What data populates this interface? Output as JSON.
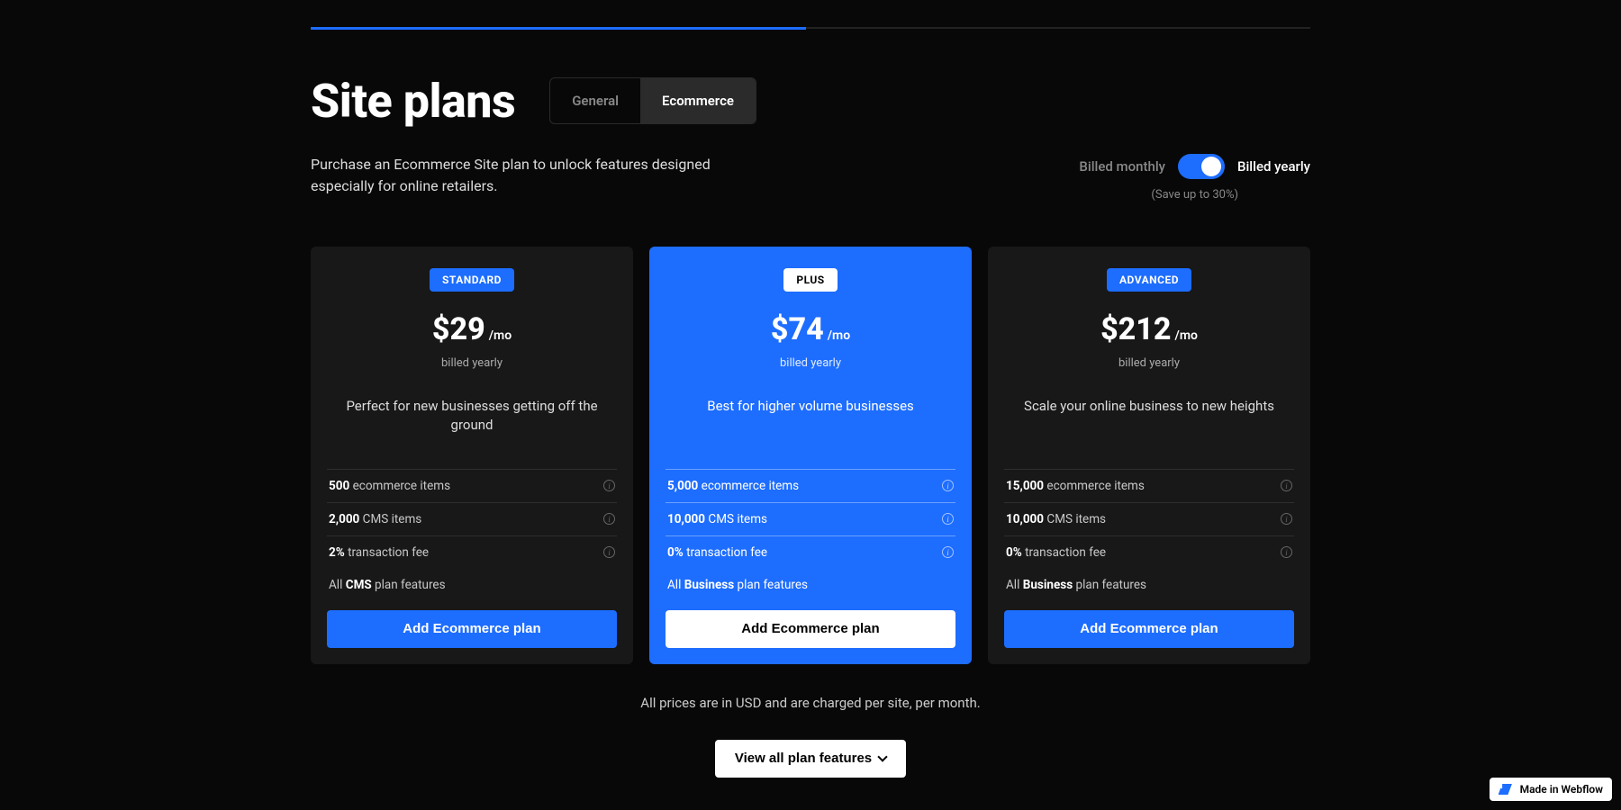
{
  "header": {
    "title": "Site plans",
    "tabs": [
      "General",
      "Ecommerce"
    ],
    "active_tab": 1
  },
  "subtitle": "Purchase an Ecommerce Site plan to unlock features designed especially for online retailers.",
  "billing": {
    "monthly_label": "Billed monthly",
    "yearly_label": "Billed yearly",
    "save_note": "(Save up to 30%)"
  },
  "plans": [
    {
      "badge": "STANDARD",
      "price": "$29",
      "suffix": "/mo",
      "billed": "billed yearly",
      "desc": "Perfect for new businesses getting off the ground",
      "features": [
        {
          "bold": "500",
          "text": " ecommerce items",
          "info": true
        },
        {
          "bold": "2,000",
          "text": " CMS items",
          "info": true
        },
        {
          "bold": "2%",
          "text": " transaction fee",
          "info": true
        }
      ],
      "all_line_prefix": "All ",
      "all_line_bold": "CMS",
      "all_line_suffix": " plan features",
      "cta": "Add Ecommerce plan"
    },
    {
      "badge": "PLUS",
      "price": "$74",
      "suffix": "/mo",
      "billed": "billed yearly",
      "desc": "Best for higher volume businesses",
      "features": [
        {
          "bold": "5,000",
          "text": " ecommerce items",
          "info": true
        },
        {
          "bold": "10,000",
          "text": " CMS items",
          "info": true
        },
        {
          "bold": "0%",
          "text": " transaction fee",
          "info": true
        }
      ],
      "all_line_prefix": "All ",
      "all_line_bold": "Business",
      "all_line_suffix": " plan features",
      "cta": "Add Ecommerce plan"
    },
    {
      "badge": "ADVANCED",
      "price": "$212",
      "suffix": "/mo",
      "billed": "billed yearly",
      "desc": "Scale your online business to new heights",
      "features": [
        {
          "bold": "15,000",
          "text": " ecommerce items",
          "info": true
        },
        {
          "bold": "10,000",
          "text": " CMS items",
          "info": true
        },
        {
          "bold": "0%",
          "text": " transaction fee",
          "info": true
        }
      ],
      "all_line_prefix": "All ",
      "all_line_bold": "Business",
      "all_line_suffix": " plan features",
      "cta": "Add Ecommerce plan"
    }
  ],
  "footer_note": "All prices are in USD and are charged per site, per month.",
  "view_all": "View all plan features",
  "webflow_badge": "Made in Webflow"
}
